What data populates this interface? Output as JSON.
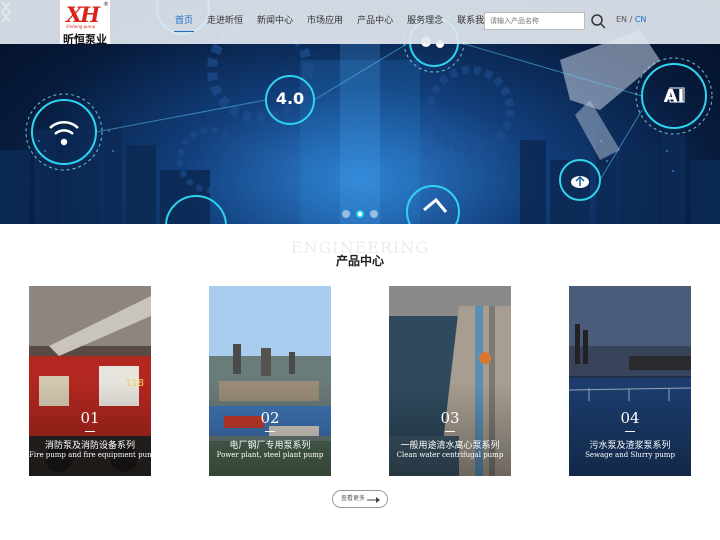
{
  "header": {
    "logo": {
      "mark": "XH",
      "sub": "Xinheng pump",
      "name": "昕恒泵业",
      "reg": "®"
    },
    "nav": [
      {
        "label": "首页",
        "active": true
      },
      {
        "label": "走进昕恒"
      },
      {
        "label": "新闻中心"
      },
      {
        "label": "市场应用"
      },
      {
        "label": "产品中心"
      },
      {
        "label": "服务理念"
      },
      {
        "label": "联系我们"
      }
    ],
    "search": {
      "placeholder": "请输入产品名称",
      "icon": "search-icon"
    },
    "lang": {
      "en": "EN",
      "sep": "/",
      "cn": "CN"
    }
  },
  "hero": {
    "badges": [
      "4.0",
      "AI"
    ],
    "icons": [
      "wifi-icon",
      "gears-icon",
      "cloud-upload-icon",
      "robot-arm-icon",
      "chip-icon"
    ],
    "accent": "#2fd3f0"
  },
  "products": {
    "bg_word": "ENGINEERING",
    "title": "产品中心",
    "items": [
      {
        "num": "01",
        "title": "消防泵及消防设备系列",
        "subtitle": "Fire pump and fire equipment pump"
      },
      {
        "num": "02",
        "title": "电厂钢厂专用泵系列",
        "subtitle": "Power plant, steel plant pump"
      },
      {
        "num": "03",
        "title": "一般用途清水离心泵系列",
        "subtitle": "Clean water centrifugal pump"
      },
      {
        "num": "04",
        "title": "污水泵及渣浆泵系列",
        "subtitle": "Sewage and Slurry pump"
      }
    ],
    "more_label": "查看更多"
  },
  "colors": {
    "brand_red": "#d9241c",
    "nav_active": "#1a6fc4",
    "hero_dark": "#071b3c"
  }
}
